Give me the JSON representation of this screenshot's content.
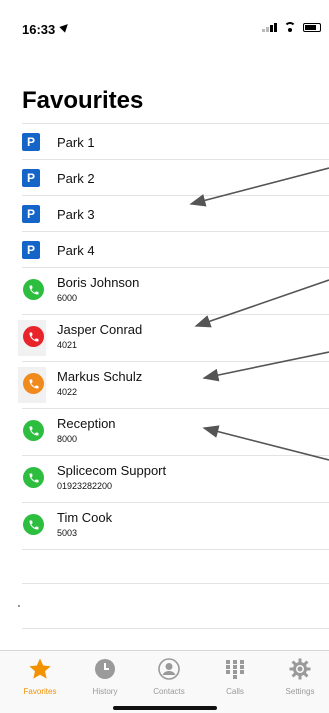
{
  "status_bar": {
    "time": "16:33"
  },
  "page_title": "Favourites",
  "parks": [
    {
      "label": "Park 1",
      "icon_letter": "P"
    },
    {
      "label": "Park 2",
      "icon_letter": "P"
    },
    {
      "label": "Park 3",
      "icon_letter": "P"
    },
    {
      "label": "Park 4",
      "icon_letter": "P"
    }
  ],
  "contacts": [
    {
      "name": "Boris Johnson",
      "ext": "6000",
      "status_color": "#2dbd3f"
    },
    {
      "name": "Jasper Conrad",
      "ext": "4021",
      "status_color": "#e8232a"
    },
    {
      "name": "Markus Schulz",
      "ext": "4022",
      "status_color": "#f08a1c"
    },
    {
      "name": "Reception",
      "ext": "8000",
      "status_color": "#2dbd3f"
    },
    {
      "name": "Splicecom Support",
      "ext": "01923282200",
      "status_color": "#2dbd3f"
    },
    {
      "name": "Tim Cook",
      "ext": "5003",
      "status_color": "#2dbd3f"
    }
  ],
  "tabs": [
    {
      "label": "Favorites",
      "icon": "star-icon",
      "active": true
    },
    {
      "label": "History",
      "icon": "clock-icon",
      "active": false
    },
    {
      "label": "Contacts",
      "icon": "contact-icon",
      "active": false
    },
    {
      "label": "Calls",
      "icon": "keypad-icon",
      "active": false
    },
    {
      "label": "Settings",
      "icon": "gear-icon",
      "active": false
    }
  ],
  "colors": {
    "accent": "#f39200",
    "park_blue": "#1565c9"
  }
}
